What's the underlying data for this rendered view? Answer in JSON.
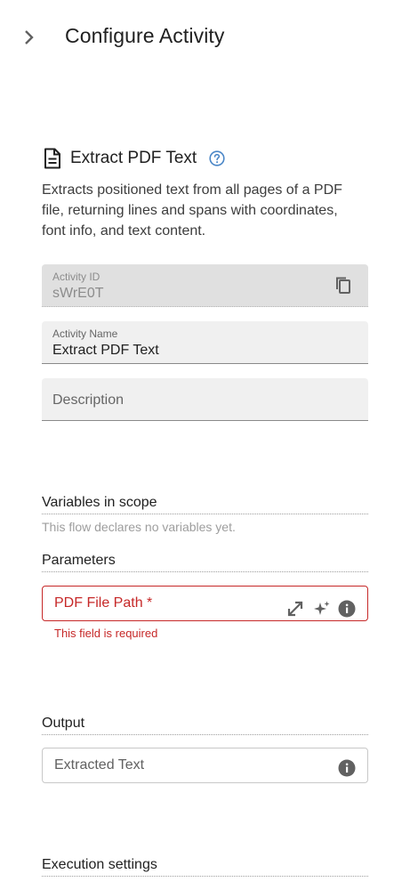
{
  "header": {
    "title": "Configure Activity",
    "collapse_icon": "chevron-right-icon"
  },
  "activity": {
    "icon": "document-icon",
    "title": "Extract PDF Text",
    "help_icon": "help-circle-icon",
    "description": "Extracts positioned text from all pages of a PDF file, returning lines and spans with coordinates, font info, and text content."
  },
  "fields": {
    "activity_id": {
      "label": "Activity ID",
      "value": "sWrE0T",
      "disabled": true,
      "action_icon": "copy-icon"
    },
    "activity_name": {
      "label": "Activity Name",
      "value": "Extract PDF Text"
    },
    "description": {
      "placeholder": "Description",
      "value": ""
    }
  },
  "variables": {
    "title": "Variables in scope",
    "empty_text": "This flow declares no variables yet."
  },
  "parameters": {
    "title": "Parameters",
    "pdf_path": {
      "label": "PDF File Path *",
      "error": "This field is required",
      "icons": [
        "expand-icon",
        "sparkle-icon",
        "info-icon"
      ]
    }
  },
  "output": {
    "title": "Output",
    "extracted_text": {
      "label": "Extracted Text",
      "icon": "info-icon"
    }
  },
  "execution": {
    "title": "Execution settings"
  },
  "colors": {
    "error": "#c62828",
    "help_accent": "#4a86c7",
    "field_fill": "#f0f0f0",
    "disabled_fill": "#e0e0e0"
  }
}
